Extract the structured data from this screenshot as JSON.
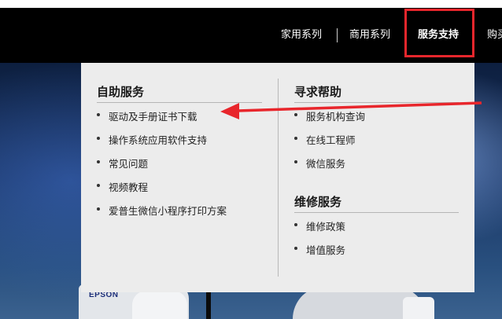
{
  "nav": {
    "items": [
      "家用系列",
      "商用系列",
      "服务支持",
      "购买"
    ]
  },
  "hero": {
    "brand": "EPSON"
  },
  "dropdown": {
    "self_service": {
      "title": "自助服务",
      "links": [
        "驱动及手册证书下载",
        "操作系统应用软件支持",
        "常见问题",
        "视频教程",
        "爱普生微信小程序打印方案"
      ]
    },
    "get_help": {
      "title": "寻求帮助",
      "links": [
        "服务机构查询",
        "在线工程师",
        "微信服务"
      ]
    },
    "repair": {
      "title": "维修服务",
      "links": [
        "维修政策",
        "增值服务"
      ]
    }
  },
  "annotations": {
    "highlight_color": "#e8262c"
  }
}
